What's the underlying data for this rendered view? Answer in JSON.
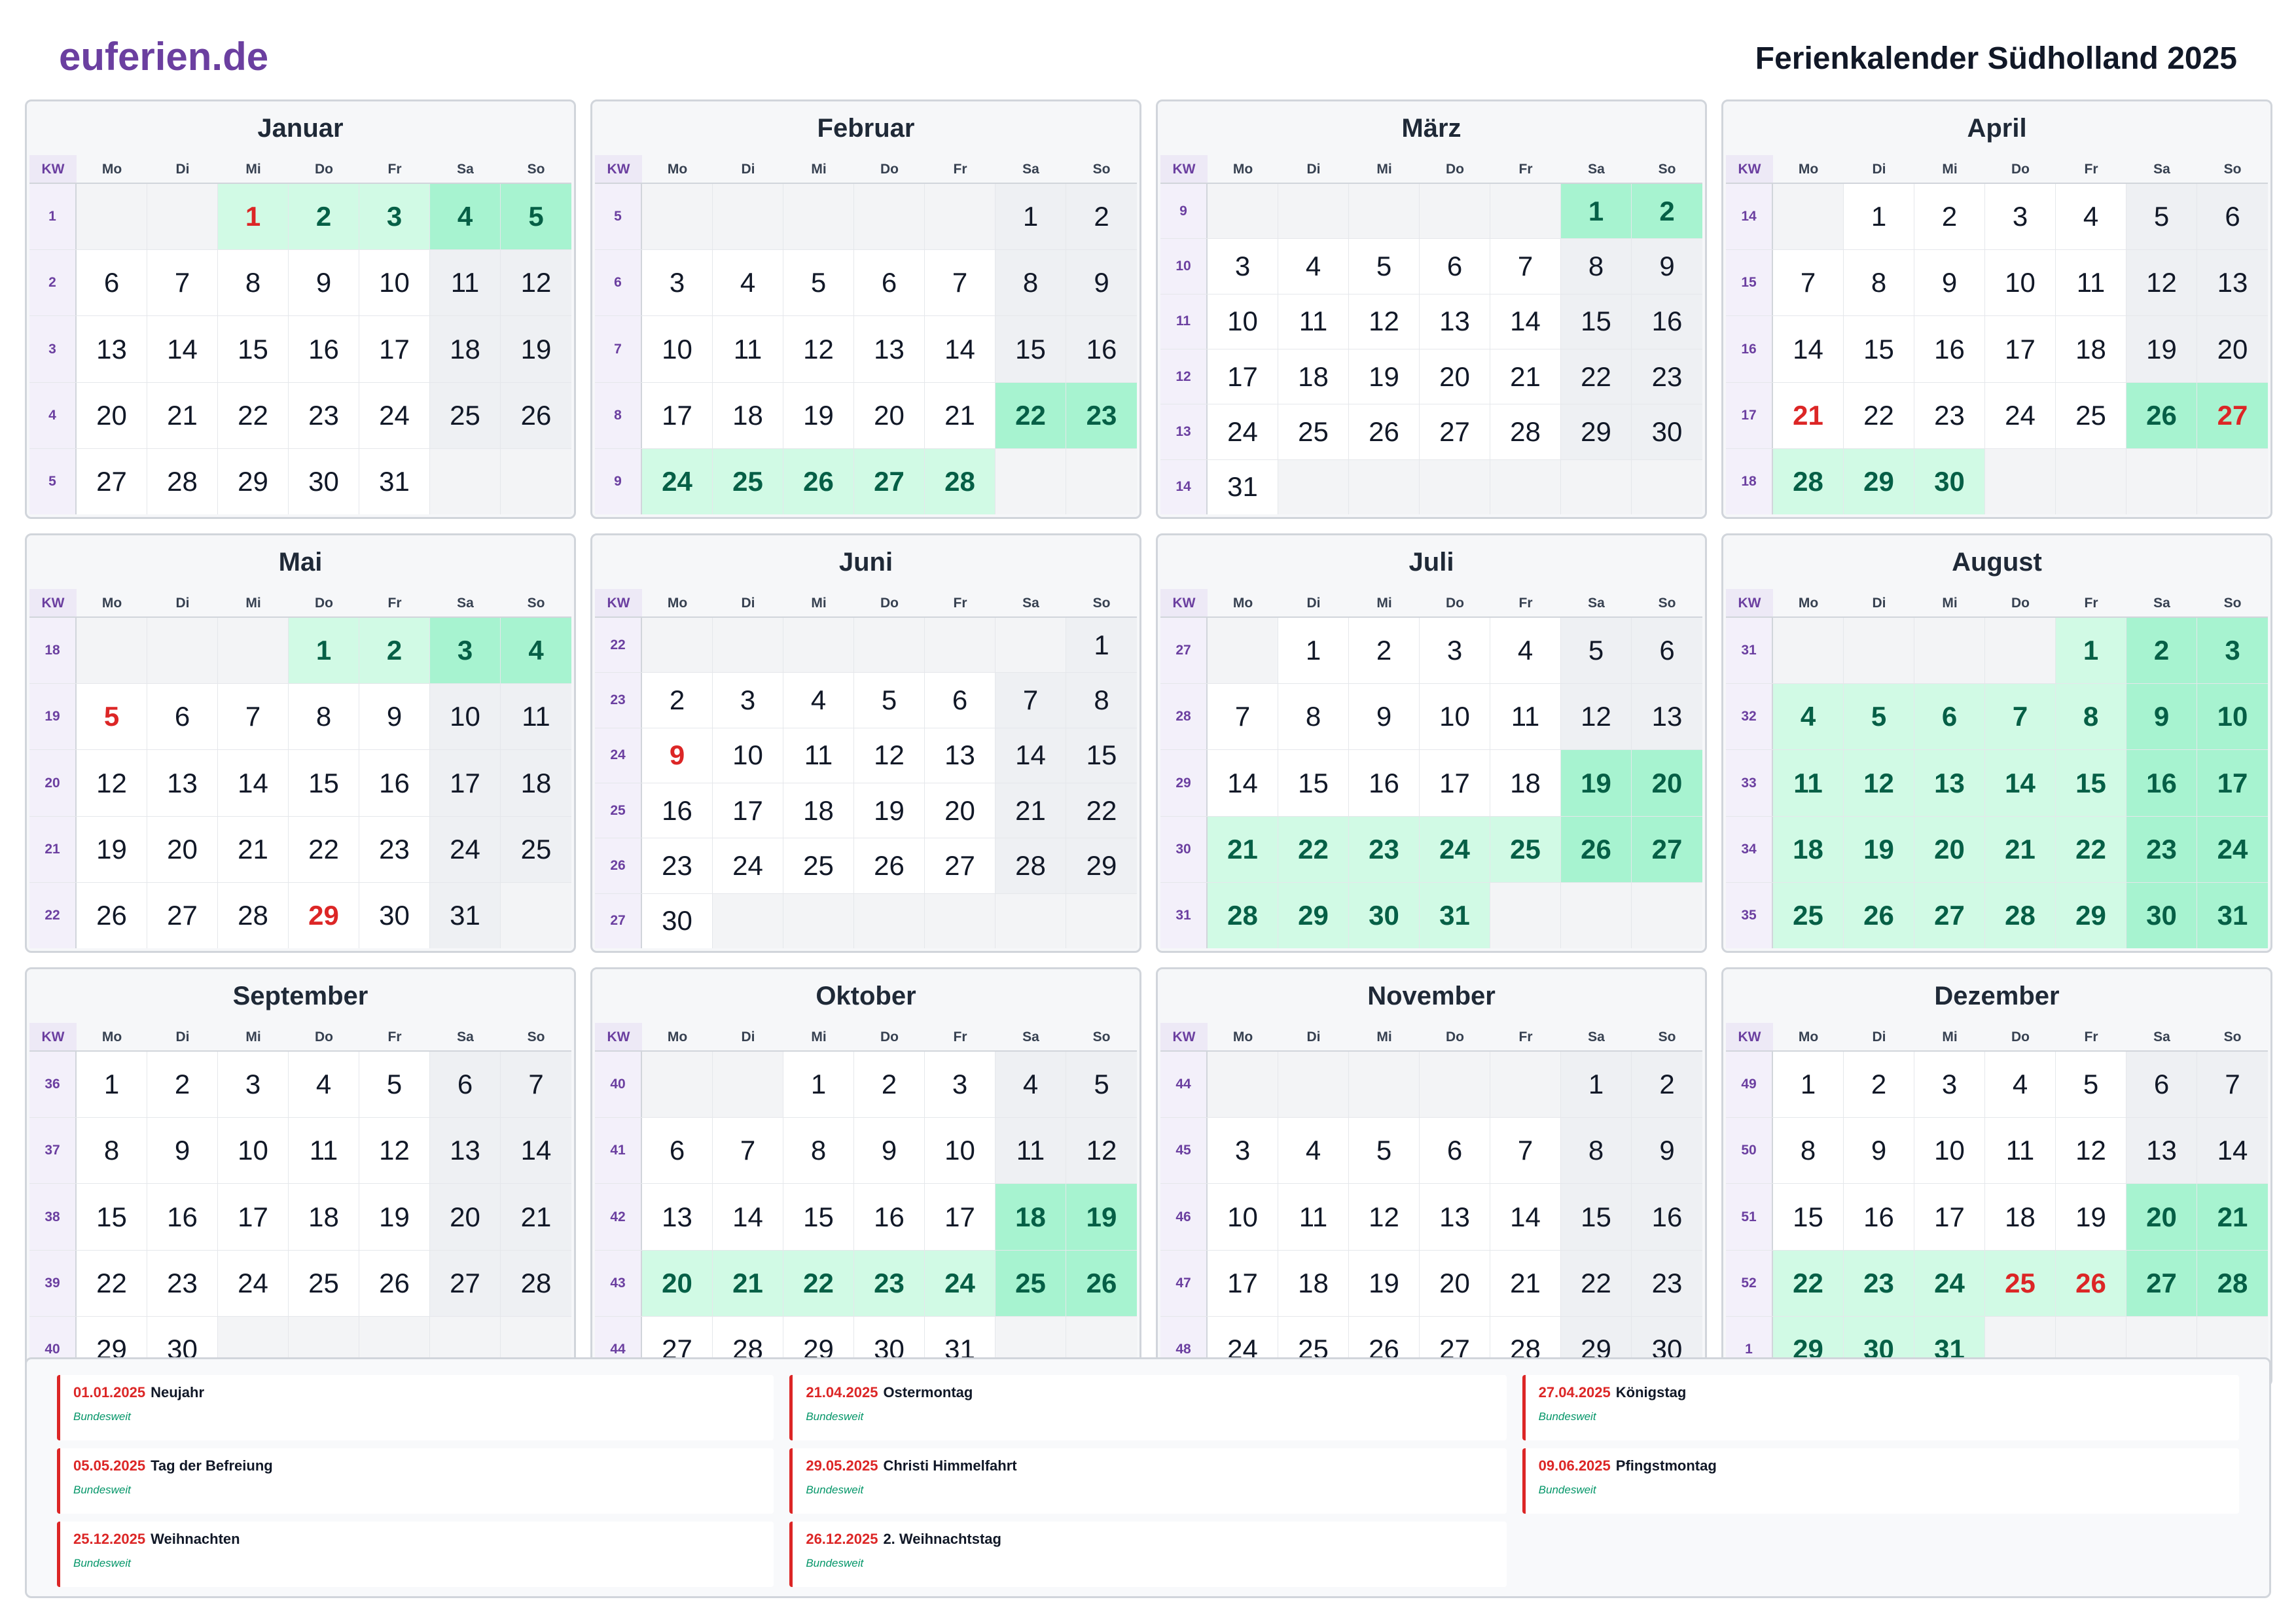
{
  "header": {
    "brand": "euferien.de",
    "title": "Ferienkalender Südholland 2025"
  },
  "weekday_header": {
    "kw": "KW",
    "days": [
      "Mo",
      "Di",
      "Mi",
      "Do",
      "Fr",
      "Sa",
      "So"
    ]
  },
  "colors": {
    "brand": "#6b3fa0",
    "holiday_bg": "#d1fae5",
    "holiday_weekend_bg": "#a7f3d0",
    "holiday_text": "#065f46",
    "public_holiday_text": "#dc2626"
  },
  "months": [
    {
      "name": "Januar",
      "rows": [
        {
          "kw": "1",
          "days": [
            "",
            "",
            "1",
            "2",
            "3",
            "4",
            "5"
          ]
        },
        {
          "kw": "2",
          "days": [
            "6",
            "7",
            "8",
            "9",
            "10",
            "11",
            "12"
          ]
        },
        {
          "kw": "3",
          "days": [
            "13",
            "14",
            "15",
            "16",
            "17",
            "18",
            "19"
          ]
        },
        {
          "kw": "4",
          "days": [
            "20",
            "21",
            "22",
            "23",
            "24",
            "25",
            "26"
          ]
        },
        {
          "kw": "5",
          "days": [
            "27",
            "28",
            "29",
            "30",
            "31",
            "",
            ""
          ]
        }
      ],
      "holidays": [
        "1",
        "2",
        "3",
        "4",
        "5"
      ],
      "public_holidays": [
        "1"
      ]
    },
    {
      "name": "Februar",
      "rows": [
        {
          "kw": "5",
          "days": [
            "",
            "",
            "",
            "",
            "",
            "1",
            "2"
          ]
        },
        {
          "kw": "6",
          "days": [
            "3",
            "4",
            "5",
            "6",
            "7",
            "8",
            "9"
          ]
        },
        {
          "kw": "7",
          "days": [
            "10",
            "11",
            "12",
            "13",
            "14",
            "15",
            "16"
          ]
        },
        {
          "kw": "8",
          "days": [
            "17",
            "18",
            "19",
            "20",
            "21",
            "22",
            "23"
          ]
        },
        {
          "kw": "9",
          "days": [
            "24",
            "25",
            "26",
            "27",
            "28",
            "",
            ""
          ]
        }
      ],
      "holidays": [
        "22",
        "23",
        "24",
        "25",
        "26",
        "27",
        "28"
      ],
      "public_holidays": []
    },
    {
      "name": "März",
      "rows": [
        {
          "kw": "9",
          "days": [
            "",
            "",
            "",
            "",
            "",
            "1",
            "2"
          ]
        },
        {
          "kw": "10",
          "days": [
            "3",
            "4",
            "5",
            "6",
            "7",
            "8",
            "9"
          ]
        },
        {
          "kw": "11",
          "days": [
            "10",
            "11",
            "12",
            "13",
            "14",
            "15",
            "16"
          ]
        },
        {
          "kw": "12",
          "days": [
            "17",
            "18",
            "19",
            "20",
            "21",
            "22",
            "23"
          ]
        },
        {
          "kw": "13",
          "days": [
            "24",
            "25",
            "26",
            "27",
            "28",
            "29",
            "30"
          ]
        },
        {
          "kw": "14",
          "days": [
            "31",
            "",
            "",
            "",
            "",
            "",
            ""
          ]
        }
      ],
      "holidays": [
        "1",
        "2"
      ],
      "public_holidays": []
    },
    {
      "name": "April",
      "rows": [
        {
          "kw": "14",
          "days": [
            "",
            "1",
            "2",
            "3",
            "4",
            "5",
            "6"
          ]
        },
        {
          "kw": "15",
          "days": [
            "7",
            "8",
            "9",
            "10",
            "11",
            "12",
            "13"
          ]
        },
        {
          "kw": "16",
          "days": [
            "14",
            "15",
            "16",
            "17",
            "18",
            "19",
            "20"
          ]
        },
        {
          "kw": "17",
          "days": [
            "21",
            "22",
            "23",
            "24",
            "25",
            "26",
            "27"
          ]
        },
        {
          "kw": "18",
          "days": [
            "28",
            "29",
            "30",
            "",
            "",
            "",
            ""
          ]
        }
      ],
      "holidays": [
        "26",
        "27",
        "28",
        "29",
        "30"
      ],
      "public_holidays": [
        "21",
        "27"
      ]
    },
    {
      "name": "Mai",
      "rows": [
        {
          "kw": "18",
          "days": [
            "",
            "",
            "",
            "1",
            "2",
            "3",
            "4"
          ]
        },
        {
          "kw": "19",
          "days": [
            "5",
            "6",
            "7",
            "8",
            "9",
            "10",
            "11"
          ]
        },
        {
          "kw": "20",
          "days": [
            "12",
            "13",
            "14",
            "15",
            "16",
            "17",
            "18"
          ]
        },
        {
          "kw": "21",
          "days": [
            "19",
            "20",
            "21",
            "22",
            "23",
            "24",
            "25"
          ]
        },
        {
          "kw": "22",
          "days": [
            "26",
            "27",
            "28",
            "29",
            "30",
            "31",
            ""
          ]
        }
      ],
      "holidays": [
        "1",
        "2",
        "3",
        "4"
      ],
      "public_holidays": [
        "5",
        "29"
      ]
    },
    {
      "name": "Juni",
      "rows": [
        {
          "kw": "22",
          "days": [
            "",
            "",
            "",
            "",
            "",
            "",
            "1"
          ]
        },
        {
          "kw": "23",
          "days": [
            "2",
            "3",
            "4",
            "5",
            "6",
            "7",
            "8"
          ]
        },
        {
          "kw": "24",
          "days": [
            "9",
            "10",
            "11",
            "12",
            "13",
            "14",
            "15"
          ]
        },
        {
          "kw": "25",
          "days": [
            "16",
            "17",
            "18",
            "19",
            "20",
            "21",
            "22"
          ]
        },
        {
          "kw": "26",
          "days": [
            "23",
            "24",
            "25",
            "26",
            "27",
            "28",
            "29"
          ]
        },
        {
          "kw": "27",
          "days": [
            "30",
            "",
            "",
            "",
            "",
            "",
            ""
          ]
        }
      ],
      "holidays": [],
      "public_holidays": [
        "9"
      ]
    },
    {
      "name": "Juli",
      "rows": [
        {
          "kw": "27",
          "days": [
            "",
            "1",
            "2",
            "3",
            "4",
            "5",
            "6"
          ]
        },
        {
          "kw": "28",
          "days": [
            "7",
            "8",
            "9",
            "10",
            "11",
            "12",
            "13"
          ]
        },
        {
          "kw": "29",
          "days": [
            "14",
            "15",
            "16",
            "17",
            "18",
            "19",
            "20"
          ]
        },
        {
          "kw": "30",
          "days": [
            "21",
            "22",
            "23",
            "24",
            "25",
            "26",
            "27"
          ]
        },
        {
          "kw": "31",
          "days": [
            "28",
            "29",
            "30",
            "31",
            "",
            "",
            ""
          ]
        }
      ],
      "holidays": [
        "19",
        "20",
        "21",
        "22",
        "23",
        "24",
        "25",
        "26",
        "27",
        "28",
        "29",
        "30",
        "31"
      ],
      "public_holidays": []
    },
    {
      "name": "August",
      "rows": [
        {
          "kw": "31",
          "days": [
            "",
            "",
            "",
            "",
            "1",
            "2",
            "3"
          ]
        },
        {
          "kw": "32",
          "days": [
            "4",
            "5",
            "6",
            "7",
            "8",
            "9",
            "10"
          ]
        },
        {
          "kw": "33",
          "days": [
            "11",
            "12",
            "13",
            "14",
            "15",
            "16",
            "17"
          ]
        },
        {
          "kw": "34",
          "days": [
            "18",
            "19",
            "20",
            "21",
            "22",
            "23",
            "24"
          ]
        },
        {
          "kw": "35",
          "days": [
            "25",
            "26",
            "27",
            "28",
            "29",
            "30",
            "31"
          ]
        }
      ],
      "holidays": [
        "1",
        "2",
        "3",
        "4",
        "5",
        "6",
        "7",
        "8",
        "9",
        "10",
        "11",
        "12",
        "13",
        "14",
        "15",
        "16",
        "17",
        "18",
        "19",
        "20",
        "21",
        "22",
        "23",
        "24",
        "25",
        "26",
        "27",
        "28",
        "29",
        "30",
        "31"
      ],
      "public_holidays": []
    },
    {
      "name": "September",
      "rows": [
        {
          "kw": "36",
          "days": [
            "1",
            "2",
            "3",
            "4",
            "5",
            "6",
            "7"
          ]
        },
        {
          "kw": "37",
          "days": [
            "8",
            "9",
            "10",
            "11",
            "12",
            "13",
            "14"
          ]
        },
        {
          "kw": "38",
          "days": [
            "15",
            "16",
            "17",
            "18",
            "19",
            "20",
            "21"
          ]
        },
        {
          "kw": "39",
          "days": [
            "22",
            "23",
            "24",
            "25",
            "26",
            "27",
            "28"
          ]
        },
        {
          "kw": "40",
          "days": [
            "29",
            "30",
            "",
            "",
            "",
            "",
            ""
          ]
        }
      ],
      "holidays": [],
      "public_holidays": []
    },
    {
      "name": "Oktober",
      "rows": [
        {
          "kw": "40",
          "days": [
            "",
            "",
            "1",
            "2",
            "3",
            "4",
            "5"
          ]
        },
        {
          "kw": "41",
          "days": [
            "6",
            "7",
            "8",
            "9",
            "10",
            "11",
            "12"
          ]
        },
        {
          "kw": "42",
          "days": [
            "13",
            "14",
            "15",
            "16",
            "17",
            "18",
            "19"
          ]
        },
        {
          "kw": "43",
          "days": [
            "20",
            "21",
            "22",
            "23",
            "24",
            "25",
            "26"
          ]
        },
        {
          "kw": "44",
          "days": [
            "27",
            "28",
            "29",
            "30",
            "31",
            "",
            ""
          ]
        }
      ],
      "holidays": [
        "18",
        "19",
        "20",
        "21",
        "22",
        "23",
        "24",
        "25",
        "26"
      ],
      "public_holidays": []
    },
    {
      "name": "November",
      "rows": [
        {
          "kw": "44",
          "days": [
            "",
            "",
            "",
            "",
            "",
            "1",
            "2"
          ]
        },
        {
          "kw": "45",
          "days": [
            "3",
            "4",
            "5",
            "6",
            "7",
            "8",
            "9"
          ]
        },
        {
          "kw": "46",
          "days": [
            "10",
            "11",
            "12",
            "13",
            "14",
            "15",
            "16"
          ]
        },
        {
          "kw": "47",
          "days": [
            "17",
            "18",
            "19",
            "20",
            "21",
            "22",
            "23"
          ]
        },
        {
          "kw": "48",
          "days": [
            "24",
            "25",
            "26",
            "27",
            "28",
            "29",
            "30"
          ]
        }
      ],
      "holidays": [],
      "public_holidays": []
    },
    {
      "name": "Dezember",
      "rows": [
        {
          "kw": "49",
          "days": [
            "1",
            "2",
            "3",
            "4",
            "5",
            "6",
            "7"
          ]
        },
        {
          "kw": "50",
          "days": [
            "8",
            "9",
            "10",
            "11",
            "12",
            "13",
            "14"
          ]
        },
        {
          "kw": "51",
          "days": [
            "15",
            "16",
            "17",
            "18",
            "19",
            "20",
            "21"
          ]
        },
        {
          "kw": "52",
          "days": [
            "22",
            "23",
            "24",
            "25",
            "26",
            "27",
            "28"
          ]
        },
        {
          "kw": "1",
          "days": [
            "29",
            "30",
            "31",
            "",
            "",
            "",
            ""
          ]
        }
      ],
      "holidays": [
        "20",
        "21",
        "22",
        "23",
        "24",
        "25",
        "26",
        "27",
        "28",
        "29",
        "30",
        "31"
      ],
      "public_holidays": [
        "25",
        "26"
      ]
    }
  ],
  "public_holidays_list": [
    {
      "date": "01.01.2025",
      "name": "Neujahr",
      "scope": "Bundesweit"
    },
    {
      "date": "21.04.2025",
      "name": "Ostermontag",
      "scope": "Bundesweit"
    },
    {
      "date": "27.04.2025",
      "name": "Königstag",
      "scope": "Bundesweit"
    },
    {
      "date": "05.05.2025",
      "name": "Tag der Befreiung",
      "scope": "Bundesweit"
    },
    {
      "date": "29.05.2025",
      "name": "Christi Himmelfahrt",
      "scope": "Bundesweit"
    },
    {
      "date": "09.06.2025",
      "name": "Pfingstmontag",
      "scope": "Bundesweit"
    },
    {
      "date": "25.12.2025",
      "name": "Weihnachten",
      "scope": "Bundesweit"
    },
    {
      "date": "26.12.2025",
      "name": "2. Weihnachtstag",
      "scope": "Bundesweit"
    }
  ]
}
